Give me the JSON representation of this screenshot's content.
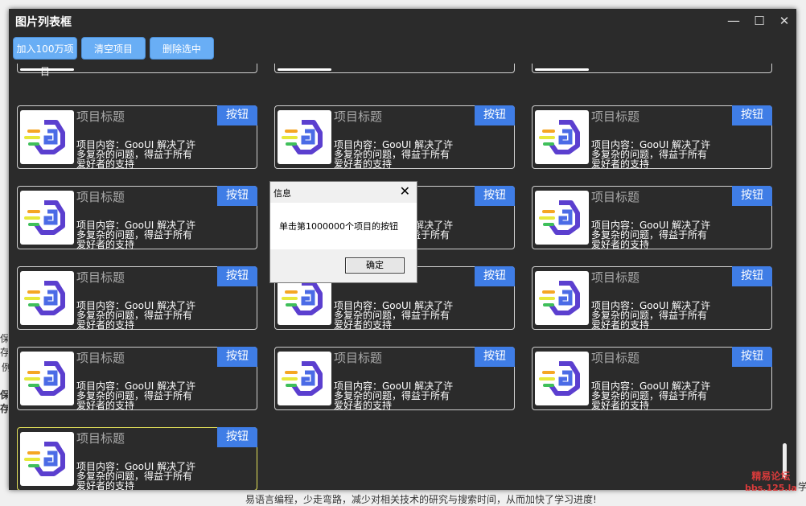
{
  "window": {
    "title": "图片列表框",
    "minimize": "—",
    "maximize": "☐",
    "close": "✕"
  },
  "toolbar": {
    "add": "加入100万项目",
    "clear": "清空项目",
    "delete": "删除选中"
  },
  "card": {
    "title": "项目标题",
    "content": "项目内容：GooUI 解决了许多复杂的问题，得益于所有爱好者的支持",
    "button": "按钮"
  },
  "dialog": {
    "title": "信息",
    "message": "单击第1000000个项目的按钮",
    "ok": "确定",
    "close": "✕"
  },
  "background": {
    "a": "保存",
    "b": "例",
    "c": "保存",
    "d": "学",
    "e": "易语言编程，少走弯路，减少对相关技术的研究与搜索时间，从而加快了学习进度!"
  },
  "watermark": {
    "line1": "精易论坛",
    "line2": "bbs.125.la"
  },
  "colors": {
    "window_bg": "#2b2b2b",
    "accent": "#3f7de6",
    "toolbar_btn": "#69aef5",
    "selected_border": "#e4e25a"
  }
}
